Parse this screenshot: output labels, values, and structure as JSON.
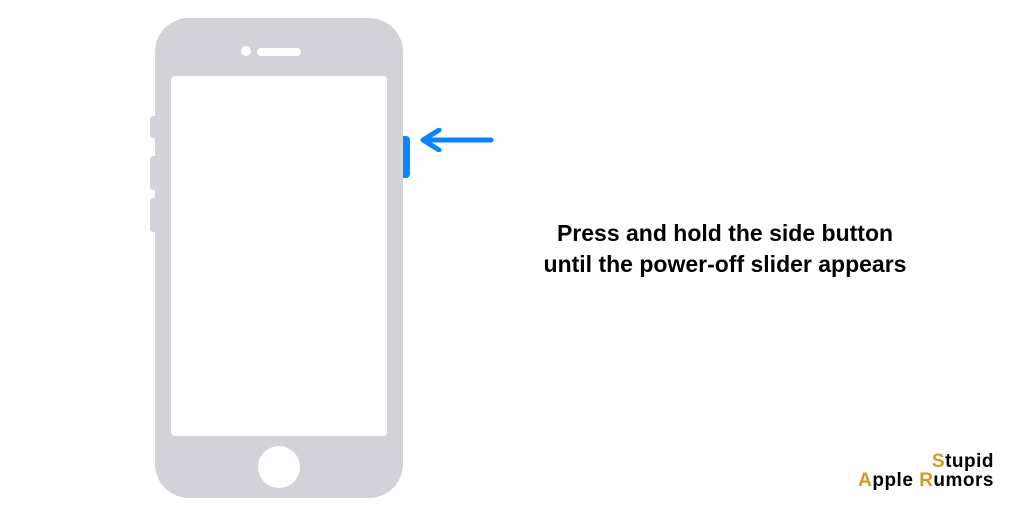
{
  "instruction": "Press and hold the side button until the power-off slider appears",
  "arrow_color": "#0a84ff",
  "highlight_color": "#0a84ff",
  "phone_color": "#d0d3d8",
  "logo": {
    "line1_cap": "S",
    "line1_rest": "tupid",
    "line2_cap_a": "A",
    "line2_word_a": "pple ",
    "line2_cap_b": "R",
    "line2_word_b": "umors"
  }
}
